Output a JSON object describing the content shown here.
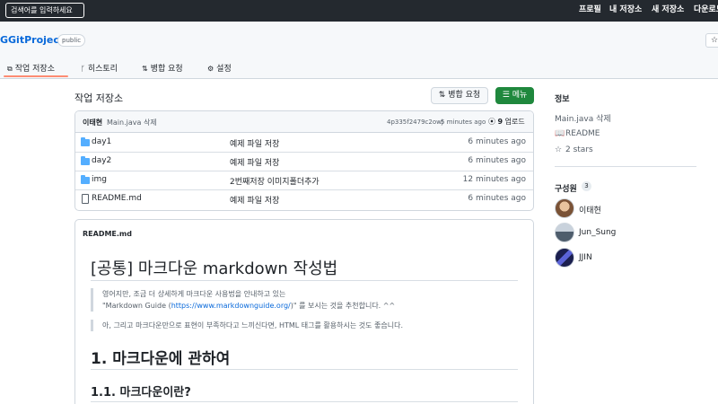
{
  "topbar": {
    "search_placeholder": "검색어를 입력하세요",
    "nav": [
      "프로필",
      "내 저장소",
      "새 저장소",
      "다운로드"
    ]
  },
  "repo": {
    "name": "GGitProject",
    "visibility": "public",
    "tabs": [
      {
        "label": "작업 저장소",
        "icon": "code-icon",
        "active": true
      },
      {
        "label": "히스토리",
        "icon": "branch-icon",
        "active": false
      },
      {
        "label": "병합 요청",
        "icon": "pull-request-icon",
        "active": false
      },
      {
        "label": "설정",
        "icon": "gear-icon",
        "active": false
      }
    ]
  },
  "main": {
    "title": "작업 저장소",
    "pr_button": "병합 요청",
    "menu_button": "메뉴",
    "commit": {
      "author": "이태현",
      "message": "Main.java 삭제",
      "hash": "4p335f2479c2owj",
      "time": "5 minutes ago",
      "count": "9",
      "count_label": "업로드"
    },
    "files": [
      {
        "name": "day1",
        "type": "folder",
        "message": "예제 파일 저장",
        "time": "6 minutes ago"
      },
      {
        "name": "day2",
        "type": "folder",
        "message": "예제 파일 저장",
        "time": "6 minutes ago"
      },
      {
        "name": "img",
        "type": "folder",
        "message": "2번째저장 이미지폴더추가",
        "time": "12 minutes ago"
      },
      {
        "name": "README.md",
        "type": "file",
        "message": "예제 파일 저장",
        "time": "6 minutes ago"
      }
    ]
  },
  "readme": {
    "label": "README.md",
    "h1": "[공통] 마크다운 markdown 작성법",
    "quote1_line1": "영어지만, 조금 더 상세하게 마크다운 사용법을 안내하고 있는",
    "quote1_pre": "\"Markdown Guide (",
    "quote1_link": "https://www.markdownguide.org/",
    "quote1_post": ")\" 를 보시는 것을 추천합니다. ^^",
    "quote2": "아, 그리고 마크다운만으로 표현이 부족하다고 느끼신다면, HTML 태그를 활용하시는 것도 좋습니다.",
    "h2": "1. 마크다운에 관하여",
    "h3": "1.1. 마크다운이란?"
  },
  "sidebar": {
    "about_title": "정보",
    "last_commit": "Main.java 삭제",
    "readme_link": "README",
    "stars": "2 stars",
    "contributors_title": "구성원",
    "contributors_count": "3",
    "contributors": [
      {
        "name": "이태현",
        "avatar_color": "#b08968"
      },
      {
        "name": "Jun_Sung",
        "avatar_color": "#6b7c8f"
      },
      {
        "name": "JJIN",
        "avatar_color": "#3a3f8f"
      }
    ]
  },
  "colors": {
    "accent_green": "#1f883d",
    "link_blue": "#0969da",
    "tab_underline": "#fd8c73",
    "topbar_bg": "#24292f"
  }
}
